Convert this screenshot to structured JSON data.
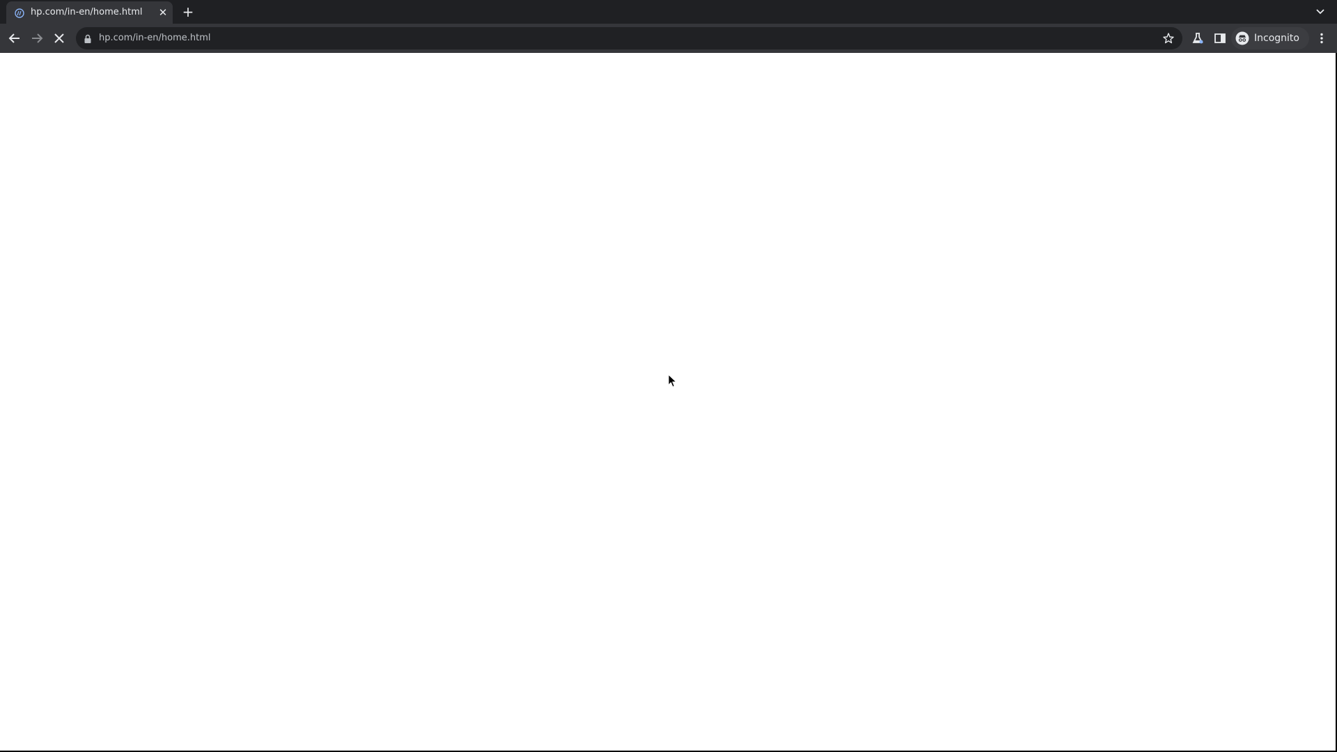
{
  "browser": {
    "tab": {
      "title": "hp.com/in-en/home.html",
      "close_glyph": "✕"
    },
    "new_tab_glyph": "+",
    "omnibox": {
      "url": "hp.com/in-en/home.html"
    },
    "profile": {
      "label": "Incognito"
    },
    "icons": {
      "favicon": "hp-favicon-icon",
      "back": "arrow-left-icon",
      "forward": "arrow-right-icon",
      "stop": "close-icon",
      "lock": "lock-icon",
      "bookmark": "star-outline-icon",
      "labs": "flask-icon",
      "side_panel": "side-panel-icon",
      "incognito": "incognito-icon",
      "menu": "kebab-menu-icon",
      "tab_search": "chevron-down-icon"
    }
  },
  "colors": {
    "tabstrip_bg": "#1f2023",
    "toolbar_bg": "#35363a",
    "omnibox_bg": "#202124",
    "text": "#e8eaed",
    "url_text": "#bdc1c6",
    "content_bg": "#ffffff"
  }
}
